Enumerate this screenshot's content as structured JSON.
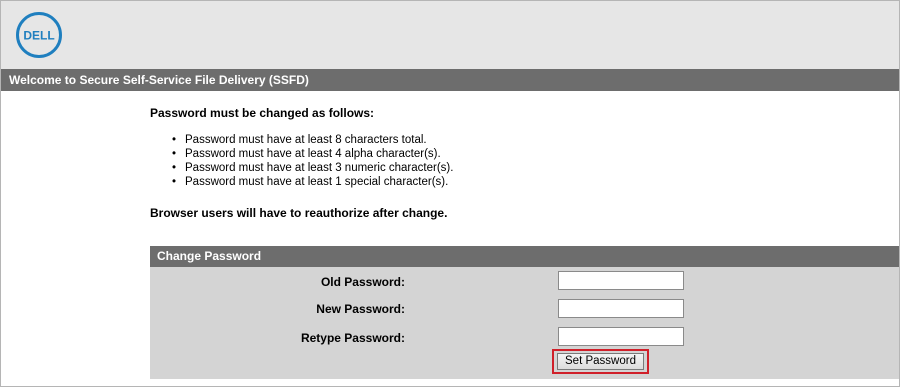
{
  "brand": {
    "logo_text": "DELL",
    "logo_icon": "dell-logo-icon",
    "logo_color": "#1f7fbf"
  },
  "titlebar": {
    "text": "Welcome to Secure Self-Service File Delivery (SSFD)"
  },
  "policy": {
    "heading": "Password must be changed as follows:",
    "rules": [
      "Password must have at least 8 characters total.",
      "Password must have at least 4 alpha character(s).",
      "Password must have at least 3 numeric character(s).",
      "Password must have at least 1 special character(s)."
    ],
    "bullet": "•",
    "note": "Browser users will have to reauthorize after change."
  },
  "change_password": {
    "title": "Change Password",
    "old_label": "Old Password:",
    "new_label": "New Password:",
    "retype_label": "Retype Password:",
    "old_value": "",
    "new_value": "",
    "retype_value": "",
    "submit_label": "Set Password"
  },
  "colors": {
    "header_bg": "#e6e6e6",
    "bar_bg": "#6d6d6d",
    "panel_bg": "#d4d4d4",
    "highlight": "#d0202a"
  }
}
